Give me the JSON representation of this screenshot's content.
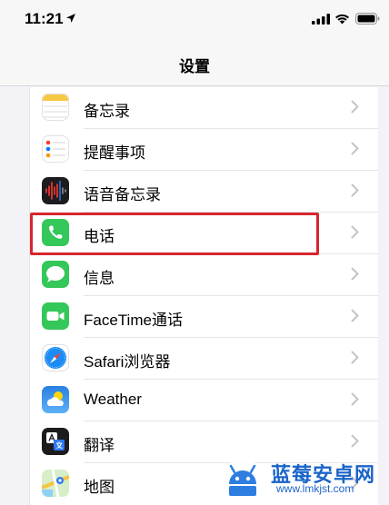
{
  "status": {
    "time": "11:21"
  },
  "nav": {
    "title": "设置"
  },
  "items": [
    {
      "label": "备忘录",
      "icon": "notes-icon"
    },
    {
      "label": "提醒事项",
      "icon": "reminders-icon"
    },
    {
      "label": "语音备忘录",
      "icon": "voice-memos-icon"
    },
    {
      "label": "电话",
      "icon": "phone-icon"
    },
    {
      "label": "信息",
      "icon": "messages-icon"
    },
    {
      "label": "FaceTime通话",
      "icon": "facetime-icon"
    },
    {
      "label": "Safari浏览器",
      "icon": "safari-icon"
    },
    {
      "label": "Weather",
      "icon": "weather-icon"
    },
    {
      "label": "翻译",
      "icon": "translate-icon"
    },
    {
      "label": "地图",
      "icon": "maps-icon"
    }
  ],
  "watermark": {
    "name": "蓝莓安卓网",
    "url": "www.lmkjst.com"
  },
  "colors": {
    "highlight": "#d6262f",
    "phone_green": "#34c759",
    "watermark_blue": "#1a64c8"
  }
}
